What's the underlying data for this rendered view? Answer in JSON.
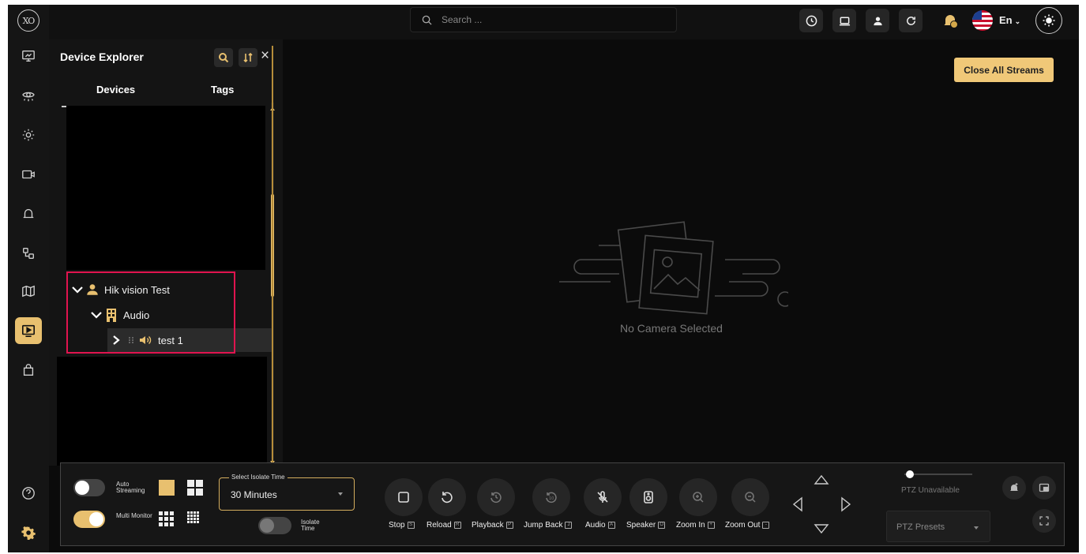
{
  "app": {
    "logo_text": "XO"
  },
  "topbar": {
    "search_placeholder": "Search ...",
    "language": "En"
  },
  "explorer": {
    "title": "Device Explorer",
    "tabs": [
      "Devices",
      "Tags"
    ],
    "tree": [
      {
        "label": "Hik vision Test",
        "level": 0,
        "expanded": true,
        "icon": "user-icon"
      },
      {
        "label": "Audio",
        "level": 1,
        "expanded": true,
        "icon": "building-icon"
      },
      {
        "label": "test 1",
        "level": 2,
        "expanded": false,
        "icon": "speaker-icon",
        "selected": true
      }
    ]
  },
  "main": {
    "close_all_label": "Close All Streams",
    "empty_text": "No Camera Selected"
  },
  "controls": {
    "auto_streaming": {
      "label": "Auto Streaming",
      "on": false
    },
    "multi_monitor": {
      "label": "Multi Monitor",
      "on": true
    },
    "isolate_select": {
      "legend": "Select Isolate Time",
      "value": "30 Minutes"
    },
    "isolate_time": {
      "label": "Isolate Time",
      "on": false
    },
    "buttons": [
      {
        "label": "Stop",
        "key": "S"
      },
      {
        "label": "Reload",
        "key": "R"
      },
      {
        "label": "Playback",
        "key": "P"
      },
      {
        "label": "Jump Back",
        "key": "J"
      },
      {
        "label": "Audio",
        "key": "A"
      },
      {
        "label": "Speaker",
        "key": "O"
      },
      {
        "label": "Zoom In",
        "key": "+"
      },
      {
        "label": "Zoom Out",
        "key": "-"
      }
    ],
    "ptz_status": "PTZ Unavailable",
    "ptz_preset": "PTZ Presets"
  },
  "colors": {
    "accent": "#e8c06f",
    "highlight": "#e0144f",
    "background": "#0b0b0b"
  }
}
